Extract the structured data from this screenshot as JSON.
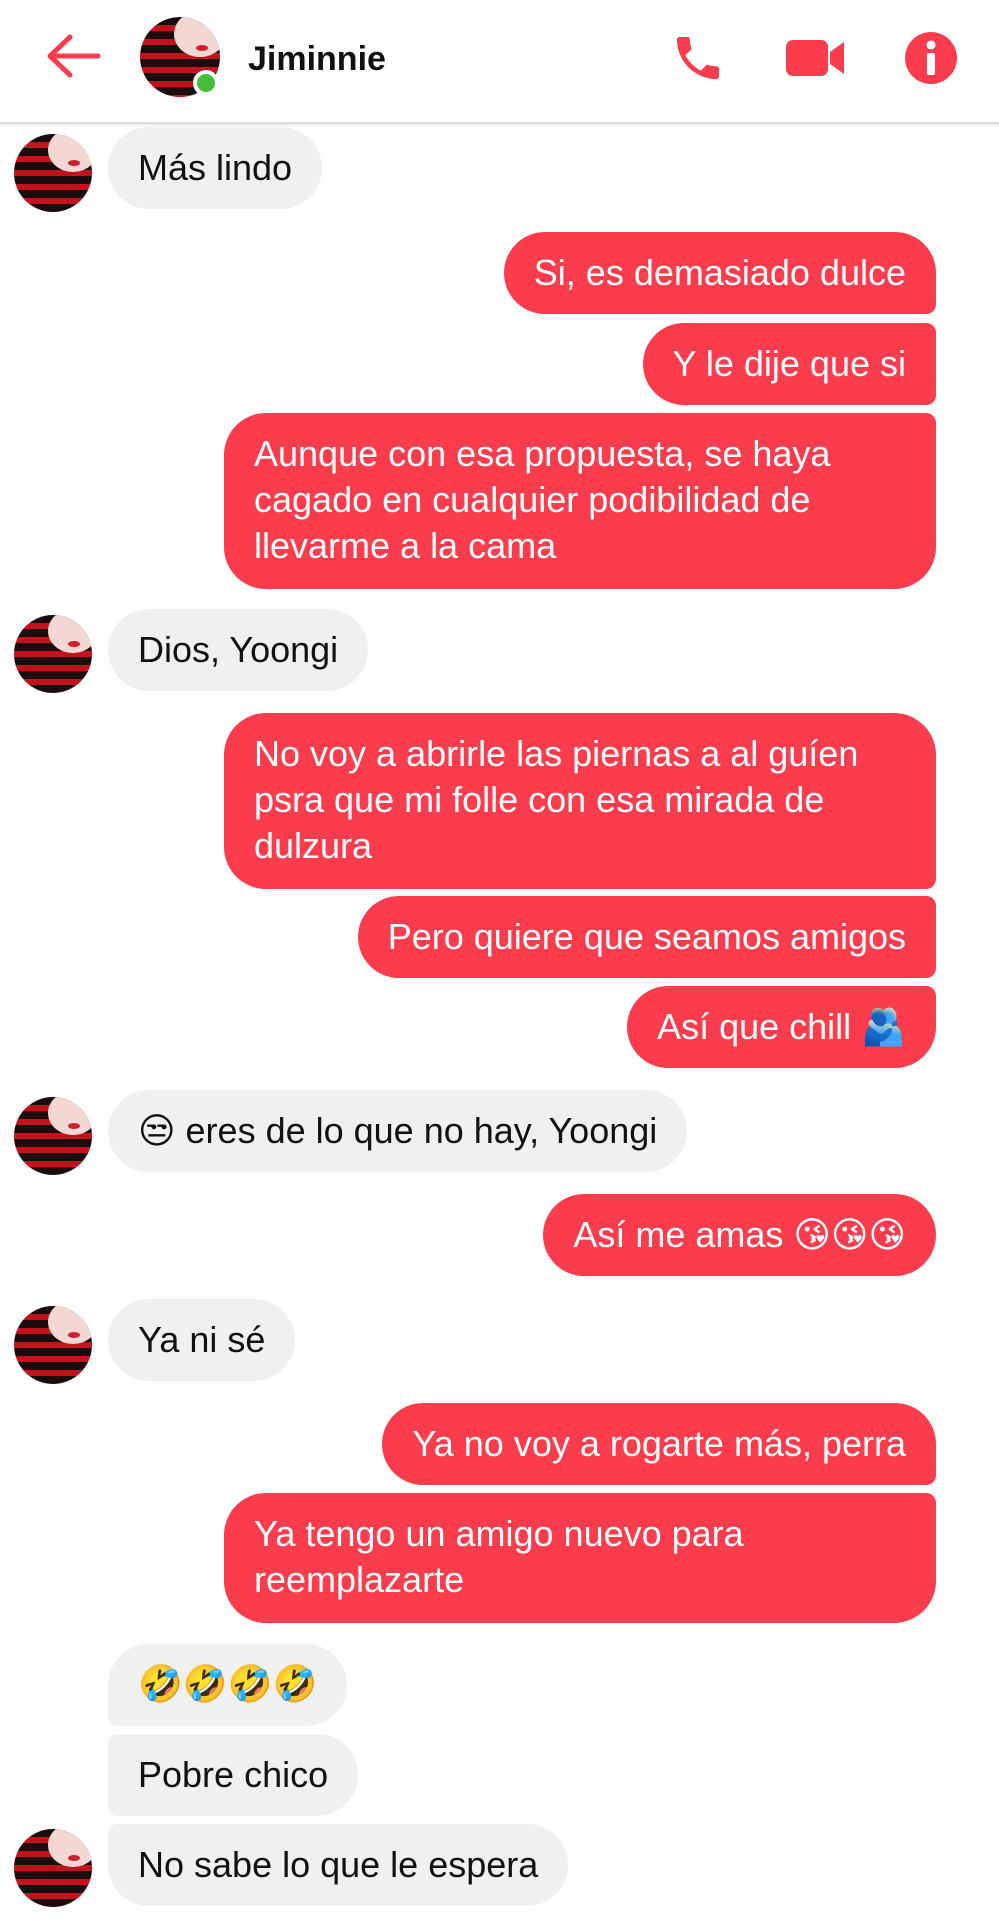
{
  "contact": {
    "name": "Jiminnie",
    "status": "online"
  },
  "colors": {
    "accent": "#fa3c4c",
    "outgoing_bubble": "#fa3c4c",
    "incoming_bubble": "#f0f0f0",
    "online": "#45bd3d"
  },
  "icons": {
    "back": "arrow-left-icon",
    "call": "phone-icon",
    "video": "video-camera-icon",
    "info": "info-icon"
  },
  "messages": [
    {
      "sender": "contact",
      "text": "Más lindo"
    },
    {
      "sender": "me",
      "text": "Si, es demasiado dulce"
    },
    {
      "sender": "me",
      "text": "Y le dije que si"
    },
    {
      "sender": "me",
      "text": "Aunque con esa propuesta, se haya cagado en cualquier podibilidad de llevarme a la cama"
    },
    {
      "sender": "contact",
      "text": "Dios, Yoongi"
    },
    {
      "sender": "me",
      "text": "No voy a abrirle las piernas a al guíen psra que mi folle con esa mirada de dulzura"
    },
    {
      "sender": "me",
      "text": "Pero quiere que seamos amigos"
    },
    {
      "sender": "me",
      "text": "Así que chill 🫂"
    },
    {
      "sender": "contact",
      "text": "😒 eres de lo que no hay, Yoongi"
    },
    {
      "sender": "me",
      "text": "Así me amas 😘😘😘"
    },
    {
      "sender": "contact",
      "text": "Ya ni sé"
    },
    {
      "sender": "me",
      "text": "Ya no voy a rogarte más, perra"
    },
    {
      "sender": "me",
      "text": "Ya tengo un amigo nuevo para reemplazarte"
    },
    {
      "sender": "contact",
      "text": "🤣🤣🤣🤣"
    },
    {
      "sender": "contact",
      "text": "Pobre chico"
    },
    {
      "sender": "contact",
      "text": "No sabe lo que le espera"
    }
  ]
}
